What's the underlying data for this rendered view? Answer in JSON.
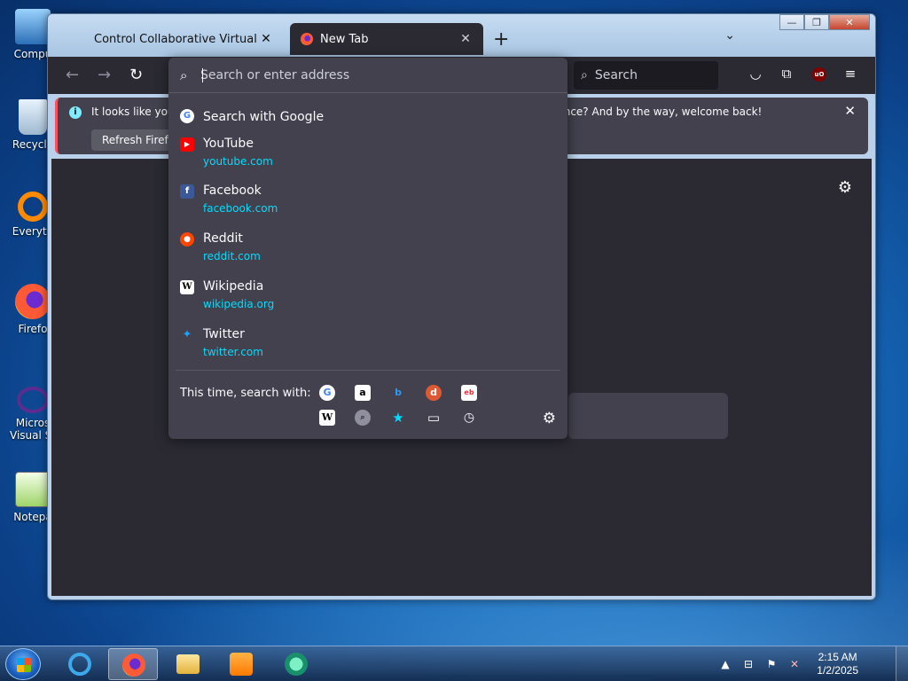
{
  "desktop": {
    "icons": [
      {
        "label": "Compu"
      },
      {
        "label": "Recycle"
      },
      {
        "label": "Everyth"
      },
      {
        "label": "Firefo"
      },
      {
        "label": "Micros Visual St"
      },
      {
        "label": "Notepa"
      }
    ]
  },
  "browser": {
    "tabs": [
      {
        "title": "Control Collaborative Virtual Machi",
        "close": "✕"
      },
      {
        "title": "New Tab",
        "close": "✕"
      }
    ],
    "new_tab": "+",
    "tabs_list": "⌄",
    "window_controls": {
      "minimize": "—",
      "maximize": "❐",
      "close": "✕"
    },
    "toolbar": {
      "back": "←",
      "forward": "→",
      "reload": "↻",
      "search_placeholder": "Search"
    },
    "notification": {
      "text_left": "It looks like you l",
      "text_right": "ience? And by the way, welcome back!",
      "button": "Refresh Firefox",
      "close": "✕"
    },
    "urlbar": {
      "placeholder": "Search or enter address",
      "search_with_google": "Search with Google",
      "results": [
        {
          "title": "YouTube",
          "url": "youtube.com",
          "icon_glyph": "▶",
          "color": "#ff0000"
        },
        {
          "title": "Facebook",
          "url": "facebook.com",
          "icon_glyph": "f",
          "color": "#3b5998"
        },
        {
          "title": "Reddit",
          "url": "reddit.com",
          "icon_glyph": "●",
          "color": "#ff4500"
        },
        {
          "title": "Wikipedia",
          "url": "wikipedia.org",
          "icon_glyph": "W",
          "color": "#ffffff"
        },
        {
          "title": "Twitter",
          "url": "twitter.com",
          "icon_glyph": "🐦",
          "color": "#1da1f2"
        }
      ],
      "one_off_label": "This time, search with:",
      "engines": [
        {
          "name": "google-icon",
          "glyph": "G",
          "bg": "#ffffff",
          "fg": "#4285f4"
        },
        {
          "name": "amazon-icon",
          "glyph": "a",
          "bg": "#ffffff",
          "fg": "#000000"
        },
        {
          "name": "bing-icon",
          "glyph": "b",
          "bg": "transparent",
          "fg": "#2b9af3"
        },
        {
          "name": "duckduckgo-icon",
          "glyph": "●",
          "bg": "#ffffff",
          "fg": "#de5833"
        },
        {
          "name": "ebay-icon",
          "glyph": "e",
          "bg": "#ffffff",
          "fg": "#e53238"
        },
        {
          "name": "wikipedia-icon",
          "glyph": "W",
          "bg": "#ffffff",
          "fg": "#000000"
        },
        {
          "name": "search-engine-icon",
          "glyph": "🔍",
          "bg": "#8f8f9d",
          "fg": "#2b2a33"
        },
        {
          "name": "bookmarks-star-icon",
          "glyph": "★",
          "bg": "transparent",
          "fg": "#00ddff"
        },
        {
          "name": "tabs-icon",
          "glyph": "▭",
          "bg": "transparent",
          "fg": "#fbfbfe"
        },
        {
          "name": "history-clock-icon",
          "glyph": "◷",
          "bg": "transparent",
          "fg": "#fbfbfe"
        }
      ]
    }
  },
  "taskbar": {
    "clock_time": "2:15 AM",
    "clock_date": "1/2/2025"
  },
  "colors": {
    "firefox_bg": "#2b2a33",
    "panel_bg": "#42414d",
    "accent_url": "#00ddff"
  }
}
